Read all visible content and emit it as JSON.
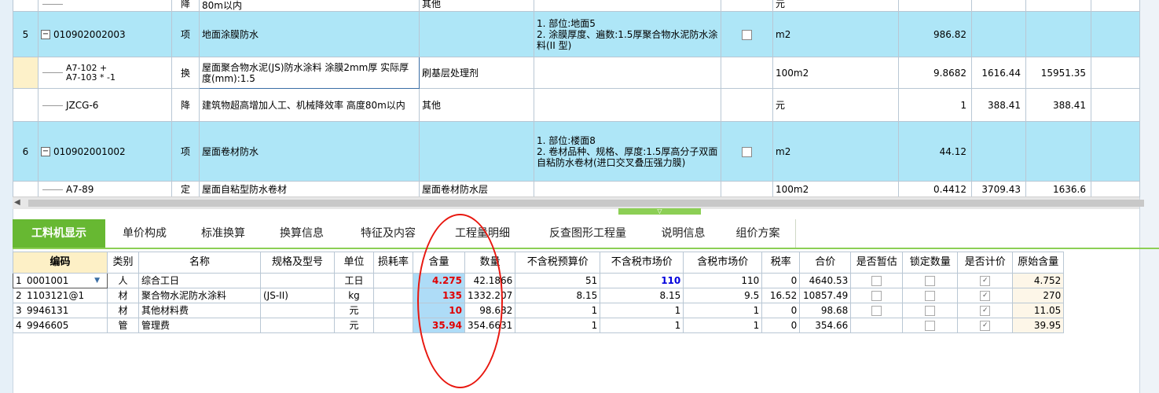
{
  "top_rows": [
    {
      "kind": "partial",
      "name": "80m以内",
      "category": "其他",
      "unit": "元"
    },
    {
      "kind": "item",
      "index": "5",
      "code": "010902002003",
      "type": "项",
      "name": "地面涂膜防水",
      "feature": "1. 部位:地面5\n2. 涂膜厚度、遍数:1.5厚聚合物水泥防水涂料(II 型)",
      "unit": "m2",
      "qty": "986.82"
    },
    {
      "kind": "sub",
      "code": "A7-102 +\nA7-103 * -1",
      "type": "换",
      "name": "屋面聚合物水泥(JS)防水涂料 涂膜2mm厚  实际厚度(mm):1.5",
      "category": "刷基层处理剂",
      "unit": "100m2",
      "qty": "9.8682",
      "price": "1616.44",
      "total": "15951.35"
    },
    {
      "kind": "sub",
      "code": "JZCG-6",
      "type": "降",
      "name": "建筑物超高增加人工、机械降效率 高度80m以内",
      "category": "其他",
      "unit": "元",
      "qty": "1",
      "price": "388.41",
      "total": "388.41"
    },
    {
      "kind": "item",
      "index": "6",
      "code": "010902001002",
      "type": "项",
      "name": "屋面卷材防水",
      "feature": "1. 部位:楼面8\n2. 卷材品种、规格、厚度:1.5厚高分子双面自粘防水卷材(进口交叉叠压强力膜)",
      "unit": "m2",
      "qty": "44.12"
    },
    {
      "kind": "sub",
      "code": "A7-89",
      "type": "定",
      "name": "屋面自粘型防水卷材",
      "category": "屋面卷材防水层",
      "unit": "100m2",
      "qty": "0.4412",
      "price": "3709.43",
      "total": "1636.6"
    }
  ],
  "tabs": [
    "工料机显示",
    "单价构成",
    "标准换算",
    "换算信息",
    "特征及内容",
    "工程量明细",
    "反查图形工程量",
    "说明信息",
    "组价方案"
  ],
  "columns": [
    "编码",
    "类别",
    "名称",
    "规格及型号",
    "单位",
    "损耗率",
    "含量",
    "数量",
    "不含税预算价",
    "不含税市场价",
    "含税市场价",
    "税率",
    "合价",
    "是否暂估",
    "锁定数量",
    "是否计价",
    "原始含量"
  ],
  "rows": [
    {
      "n": "1",
      "code": "0001001",
      "type": "人",
      "name": "综合工日",
      "spec": "",
      "unit": "工日",
      "loss": "",
      "content": "4.275",
      "qty": "42.1866",
      "budget": "51",
      "market": "110",
      "tax_market": "110",
      "rate": "0",
      "total": "4640.53",
      "provisional": false,
      "locked": false,
      "priced": true,
      "orig": "4.752"
    },
    {
      "n": "2",
      "code": "1103121@1",
      "type": "材",
      "name": "聚合物水泥防水涂料",
      "spec": "(JS-II)",
      "unit": "kg",
      "loss": "",
      "content": "135",
      "qty": "1332.207",
      "budget": "8.15",
      "market": "8.15",
      "tax_market": "9.5",
      "rate": "16.52",
      "total": "10857.49",
      "provisional": false,
      "locked": false,
      "priced": true,
      "orig": "270"
    },
    {
      "n": "3",
      "code": "9946131",
      "type": "材",
      "name": "其他材料费",
      "spec": "",
      "unit": "元",
      "loss": "",
      "content": "10",
      "qty": "98.682",
      "budget": "1",
      "market": "1",
      "tax_market": "1",
      "rate": "0",
      "total": "98.68",
      "provisional": false,
      "locked": false,
      "priced": true,
      "orig": "11.05"
    },
    {
      "n": "4",
      "code": "9946605",
      "type": "管",
      "name": "管理费",
      "spec": "",
      "unit": "元",
      "loss": "",
      "content": "35.94",
      "qty": "354.6631",
      "budget": "1",
      "market": "1",
      "tax_market": "1",
      "rate": "0",
      "total": "354.66",
      "provisional": null,
      "locked": false,
      "priced": true,
      "orig": "39.95"
    }
  ],
  "colors": {
    "tab_active": "#67b832",
    "row_highlight": "#aee6f7",
    "content_text": "#e00000",
    "market_text": "#0000dd",
    "annotation": "#e8170f"
  }
}
